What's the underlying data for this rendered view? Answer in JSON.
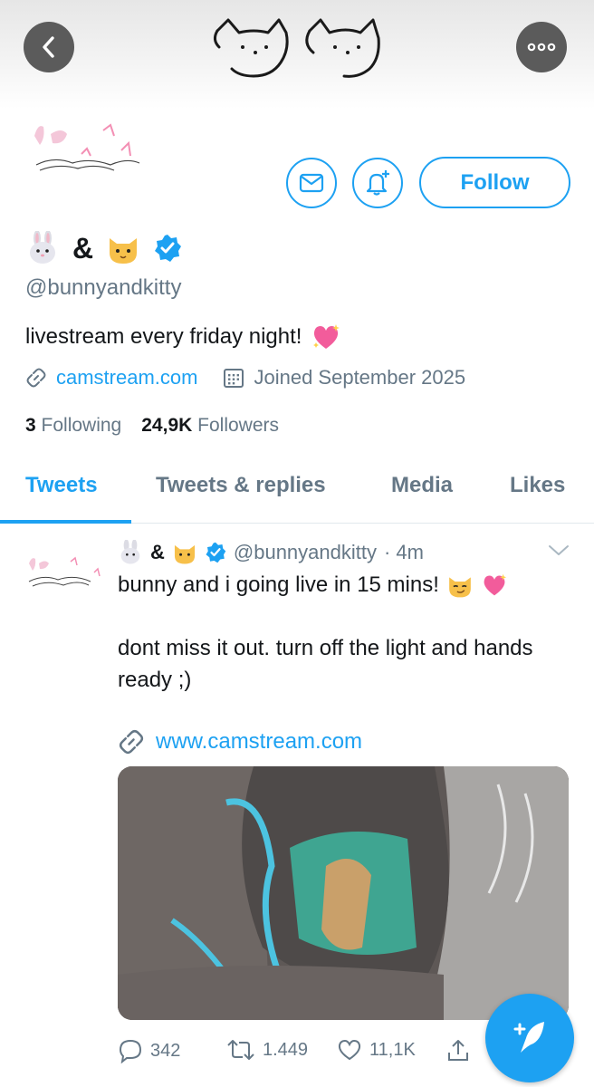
{
  "header": {
    "back_icon": "chevron-left-icon",
    "more_icon": "more-dots-icon"
  },
  "profile": {
    "display_name_amp": "&",
    "handle": "@bunnyandkitty",
    "bio": "livestream every friday night!",
    "website": "camstream.com",
    "joined": "Joined September 2025",
    "following_count": "3",
    "following_label": "Following",
    "followers_count": "24,9K",
    "followers_label": "Followers",
    "follow_label": "Follow",
    "verified": true
  },
  "tabs": [
    {
      "label": "Tweets",
      "active": true
    },
    {
      "label": "Tweets & replies",
      "active": false
    },
    {
      "label": "Media",
      "active": false
    },
    {
      "label": "Likes",
      "active": false
    }
  ],
  "tweet": {
    "name_amp": "&",
    "handle": "@bunnyandkitty",
    "time": "· 4m",
    "line1": "bunny and i going live in 15 mins!",
    "line2": "dont miss it out. turn off the light and hands ready ;)",
    "link": "www.camstream.com",
    "replies": "342",
    "retweets": "1.449",
    "likes": "11,1K"
  },
  "colors": {
    "accent": "#1da1f2",
    "secondary_text": "#657786",
    "heart_pink": "#f25c9b"
  }
}
